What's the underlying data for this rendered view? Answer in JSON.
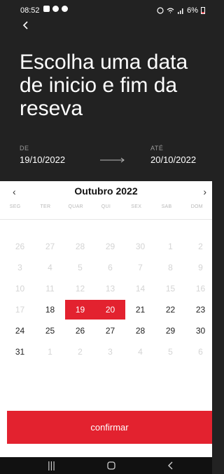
{
  "status_bar": {
    "time": "08:52",
    "battery": "6%"
  },
  "header": {
    "title": "Escolha uma data de inicio e fim da reseva"
  },
  "range": {
    "start_label": "DE",
    "start_value": "19/10/2022",
    "end_label": "ATÉ",
    "end_value": "20/10/2022"
  },
  "calendar": {
    "month_label": "Outubro 2022",
    "weekdays": [
      "SEG",
      "TER",
      "QUAR",
      "QUI",
      "SEX",
      "SAB",
      "DOM"
    ],
    "rows": [
      [
        "26",
        "27",
        "28",
        "29",
        "30",
        "1",
        "2"
      ],
      [
        "3",
        "4",
        "5",
        "6",
        "7",
        "8",
        "9"
      ],
      [
        "10",
        "11",
        "12",
        "13",
        "14",
        "15",
        "16"
      ],
      [
        "17",
        "18",
        "19",
        "20",
        "21",
        "22",
        "23"
      ],
      [
        "24",
        "25",
        "26",
        "27",
        "28",
        "29",
        "30"
      ],
      [
        "31",
        "1",
        "2",
        "3",
        "4",
        "5",
        "6"
      ]
    ],
    "selected": [
      "19",
      "20"
    ]
  },
  "confirm_label": "confirmar",
  "colors": {
    "accent": "#e3222f",
    "dark_bg": "#222222"
  }
}
